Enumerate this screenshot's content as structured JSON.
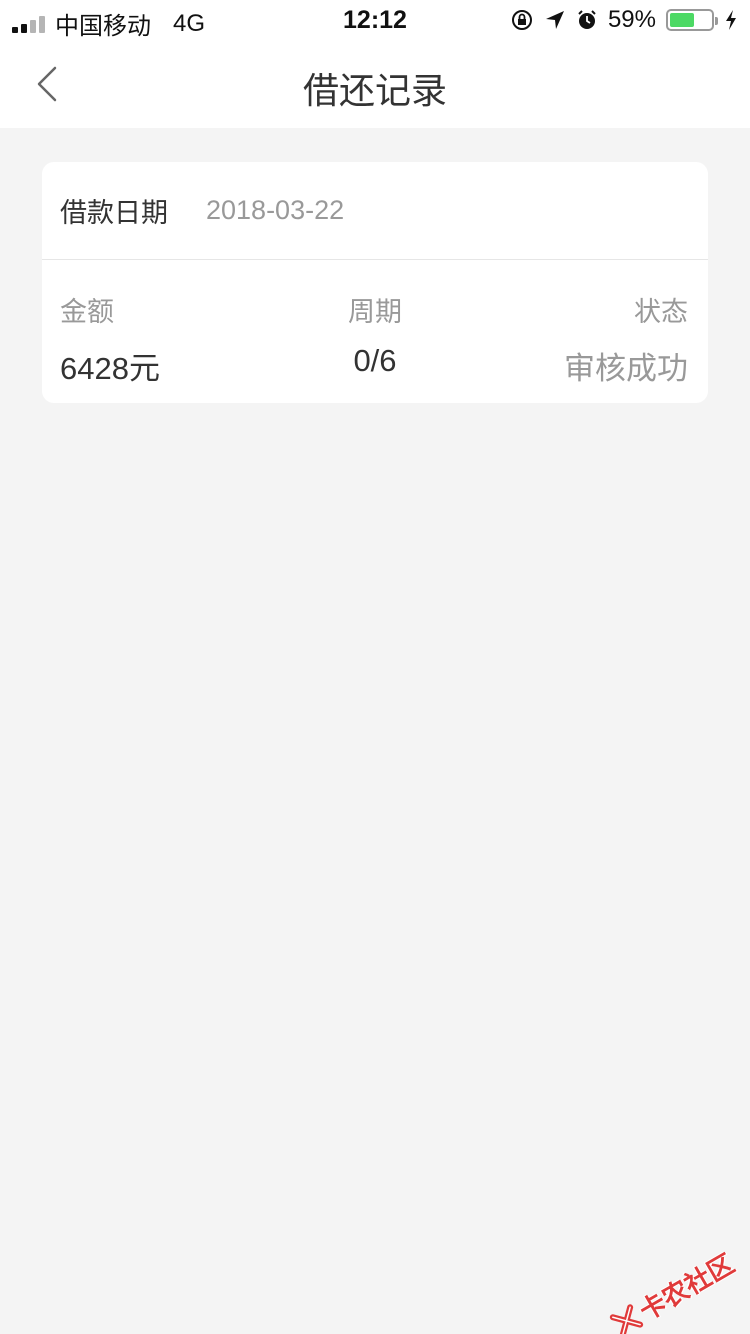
{
  "status_bar": {
    "carrier": "中国移动",
    "network": "4G",
    "time": "12:12",
    "battery_percent": "59%",
    "battery_level": 0.59,
    "battery_color": "#4cd964"
  },
  "nav": {
    "title": "借还记录",
    "back_icon": "chevron-left-icon"
  },
  "record": {
    "loan_date_label": "借款日期",
    "loan_date_value": "2018-03-22",
    "amount_label": "金额",
    "amount_value": "6428元",
    "period_label": "周期",
    "period_value": "0/6",
    "status_label": "状态",
    "status_value": "审核成功"
  },
  "watermark": {
    "text": "卡农社区",
    "color": "#e03a3a"
  }
}
